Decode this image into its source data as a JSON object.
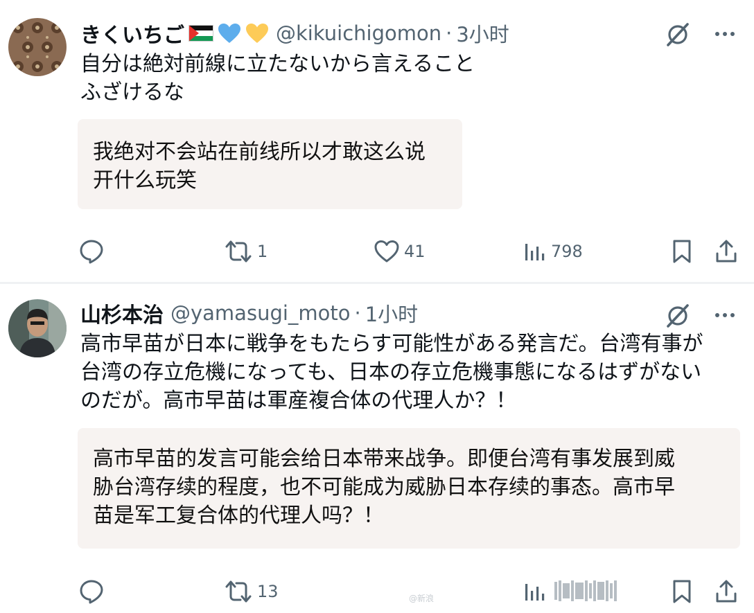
{
  "tweets": [
    {
      "display_name": "きくいちご",
      "handle": "@kikuichigomon",
      "separator": "·",
      "time": "3小时",
      "text_lines": [
        "自分は絶対前線に立たないから言えること",
        "ふざけるな"
      ],
      "translation_lines": [
        "我绝对不会站在前线所以才敢这么说",
        "开什么玩笑"
      ],
      "counts": {
        "reply": "",
        "retweet": "1",
        "like": "41",
        "views": "798"
      },
      "icons": [
        "palestine-flag-emoji",
        "blue-heart-emoji",
        "yellow-heart-emoji"
      ]
    },
    {
      "display_name": "山杉本治",
      "handle": "@yamasugi_moto",
      "separator": "·",
      "time": "1小时",
      "text_lines": [
        "高市早苗が日本に戦争をもたらす可能性がある発言だ。台湾有事が",
        "台湾の存立危機になっても、日本の存立危機事態になるはずがない",
        "のだが。高市早苗は軍産複合体の代理人か？！"
      ],
      "translation_lines": [
        "高市早苗的发言可能会给日本带来战争。即便台湾有事发展到威",
        "胁台湾存续的程度，也不可能成为威胁日本存续的事态。高市早",
        "苗是军工复合体的代理人吗？！"
      ],
      "counts": {
        "reply": "",
        "retweet": "13"
      },
      "watermark": "@新浪"
    }
  ],
  "colors": {
    "text": "#0f1419",
    "secondary": "#536471",
    "translation_bg": "#f7f3f1",
    "divider": "#eff1f3"
  }
}
